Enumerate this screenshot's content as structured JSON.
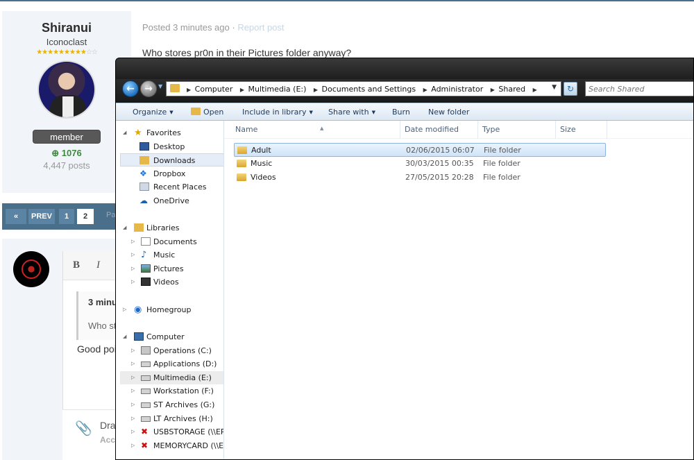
{
  "forum": {
    "author_name": "Shiranui",
    "author_title": "Iconoclast",
    "stars_on": "★★★★★★★★★",
    "stars_off": "☆☆",
    "badge": "member",
    "reputation": "1076",
    "post_count": "4,447 posts",
    "post_meta": "Posted 3 minutes ago · ",
    "report_link": "Report post",
    "post_text": "Who stores pr0n in their Pictures folder anyway?",
    "pager": {
      "prev": "PREV",
      "page1": "1",
      "page2": "2",
      "page_label": "Pa",
      "first_icon": "«"
    },
    "editor": {
      "bold": "B",
      "italic": "I"
    },
    "quote_head": "3 minu",
    "quote_body": "Who st",
    "reply_text": "Good poi",
    "attach_drag": "Dra",
    "attach_accepted": "Acc"
  },
  "explorer": {
    "breadcrumbs": [
      "Computer",
      "Multimedia (E:)",
      "Documents and Settings",
      "Administrator",
      "Shared"
    ],
    "search_placeholder": "Search Shared",
    "commands": {
      "organize": "Organize",
      "open": "Open",
      "include": "Include in library",
      "share": "Share with",
      "burn": "Burn",
      "newfolder": "New folder"
    },
    "nav": {
      "favorites": "Favorites",
      "desktop": "Desktop",
      "downloads": "Downloads",
      "dropbox": "Dropbox",
      "recent": "Recent Places",
      "onedrive": "OneDrive",
      "libraries": "Libraries",
      "documents": "Documents",
      "music": "Music",
      "pictures": "Pictures",
      "videos": "Videos",
      "homegroup": "Homegroup",
      "computer": "Computer",
      "drive_c": "Operations (C:)",
      "drive_d": "Applications (D:)",
      "drive_e": "Multimedia (E:)",
      "drive_f": "Workstation (F:)",
      "drive_g": "ST Archives (G:)",
      "drive_h": "LT Archives (H:)",
      "usb": "USBSTORAGE (\\\\EPS",
      "memcard": "MEMORYCARD (\\\\E"
    },
    "columns": {
      "name": "Name",
      "date": "Date modified",
      "type": "Type",
      "size": "Size"
    },
    "files": [
      {
        "name": "Adult",
        "date": "02/06/2015 06:07",
        "type": "File folder"
      },
      {
        "name": "Music",
        "date": "30/03/2015 00:35",
        "type": "File folder"
      },
      {
        "name": "Videos",
        "date": "27/05/2015 20:28",
        "type": "File folder"
      }
    ],
    "colors": {
      "selection": "#cfe4f9",
      "folder": "#e6b84a",
      "command_text": "#1e395b"
    }
  }
}
